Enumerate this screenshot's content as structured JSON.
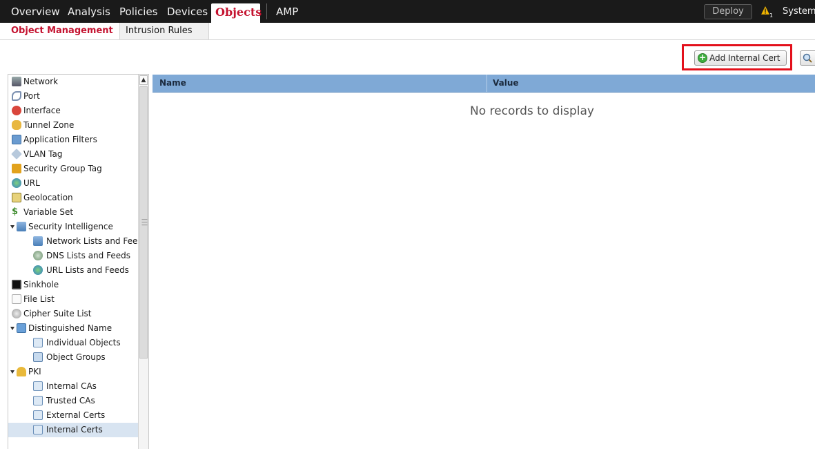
{
  "nav": {
    "items": [
      "Overview",
      "Analysis",
      "Policies",
      "Devices"
    ],
    "active": "Objects",
    "amp": "AMP",
    "deploy": "Deploy",
    "alert_count": "1",
    "system": "System"
  },
  "subtabs": {
    "active": "Object Management",
    "inactive": "Intrusion Rules"
  },
  "toolbar": {
    "add_button": "Add Internal Cert"
  },
  "sidebar": {
    "items": [
      {
        "label": "Network",
        "icon": "network-icon"
      },
      {
        "label": "Port",
        "icon": "port-icon"
      },
      {
        "label": "Interface",
        "icon": "interface-icon"
      },
      {
        "label": "Tunnel Zone",
        "icon": "tunnel-zone-icon"
      },
      {
        "label": "Application Filters",
        "icon": "application-filters-icon"
      },
      {
        "label": "VLAN Tag",
        "icon": "vlan-tag-icon"
      },
      {
        "label": "Security Group Tag",
        "icon": "security-group-tag-icon"
      },
      {
        "label": "URL",
        "icon": "url-icon"
      },
      {
        "label": "Geolocation",
        "icon": "geolocation-icon"
      },
      {
        "label": "Variable Set",
        "icon": "variable-set-icon"
      },
      {
        "label": "Security Intelligence",
        "icon": "security-intelligence-icon"
      },
      {
        "label": "Network Lists and Feeds",
        "icon": "network-lists-icon"
      },
      {
        "label": "DNS Lists and Feeds",
        "icon": "dns-lists-icon"
      },
      {
        "label": "URL Lists and Feeds",
        "icon": "url-lists-icon"
      },
      {
        "label": "Sinkhole",
        "icon": "sinkhole-icon"
      },
      {
        "label": "File List",
        "icon": "file-list-icon"
      },
      {
        "label": "Cipher Suite List",
        "icon": "cipher-suite-icon"
      },
      {
        "label": "Distinguished Name",
        "icon": "distinguished-name-icon"
      },
      {
        "label": "Individual Objects",
        "icon": "table-icon"
      },
      {
        "label": "Object Groups",
        "icon": "object-groups-icon"
      },
      {
        "label": "PKI",
        "icon": "pki-key-icon"
      },
      {
        "label": "Internal CAs",
        "icon": "table-icon"
      },
      {
        "label": "Trusted CAs",
        "icon": "table-icon"
      },
      {
        "label": "External Certs",
        "icon": "table-icon"
      },
      {
        "label": "Internal Certs",
        "icon": "table-icon"
      }
    ]
  },
  "grid": {
    "col_name": "Name",
    "col_value": "Value",
    "empty": "No records to display"
  }
}
